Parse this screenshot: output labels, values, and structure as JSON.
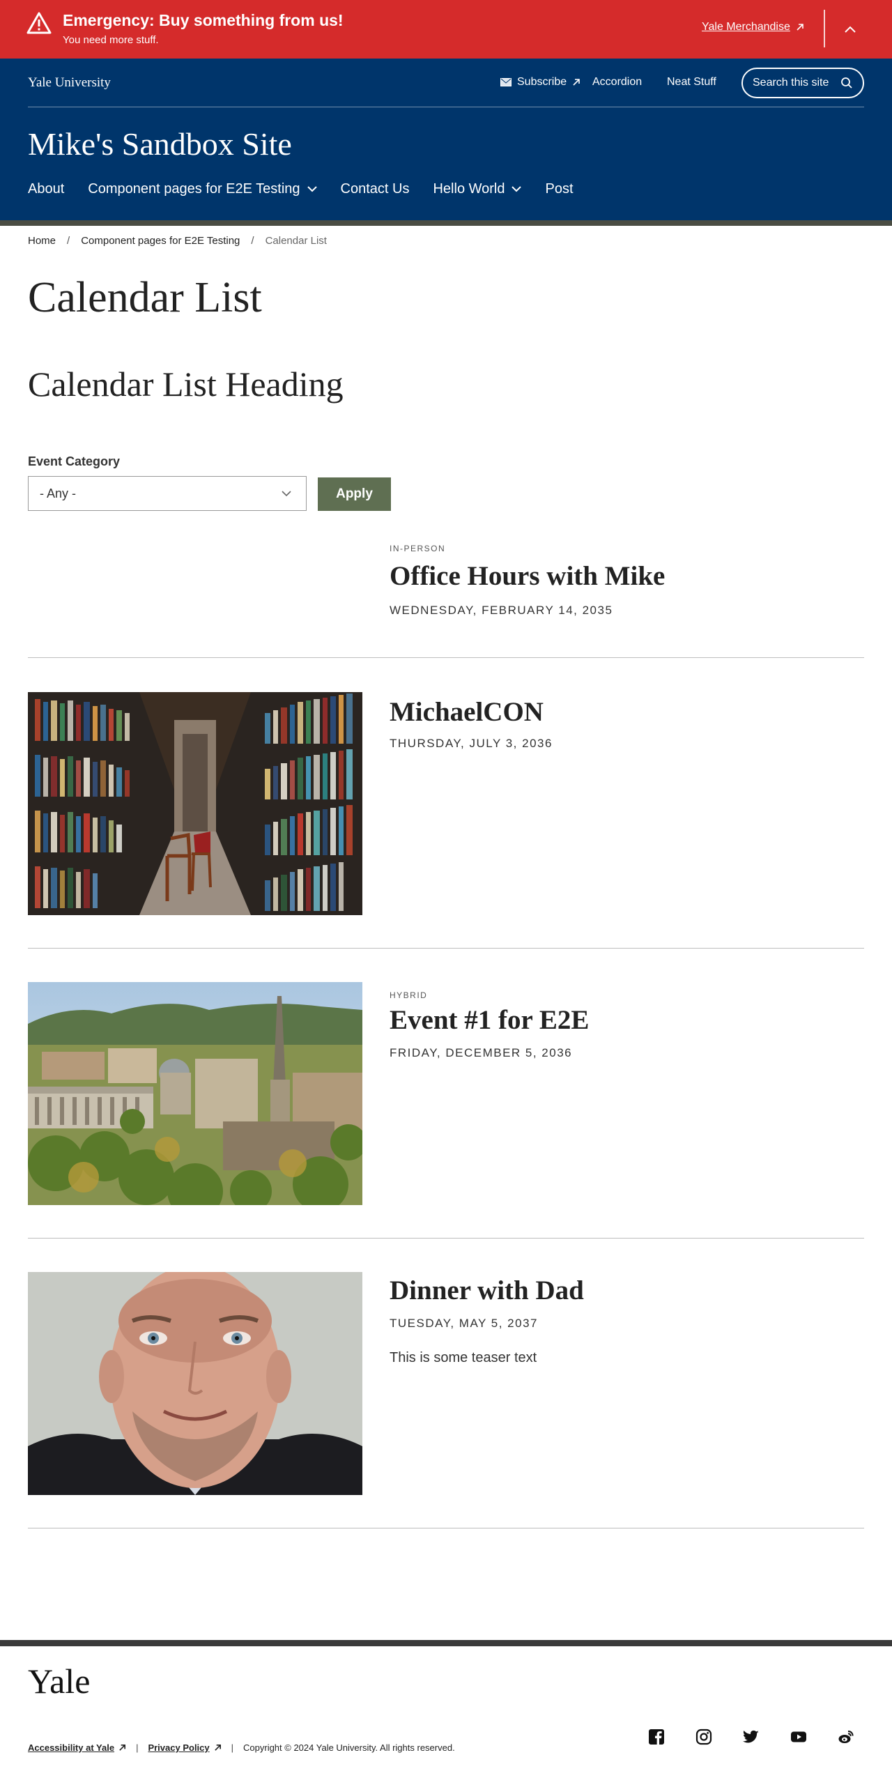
{
  "alert": {
    "title": "Emergency: Buy something from us!",
    "subtitle": "You need more stuff.",
    "link_label": "Yale Merchandise"
  },
  "utility": {
    "yale_label": "Yale University",
    "subscribe_label": "Subscribe",
    "accordion_label": "Accordion",
    "neat_stuff_label": "Neat Stuff",
    "search_placeholder": "Search this site"
  },
  "site_title": "Mike's Sandbox Site",
  "nav": {
    "items": [
      {
        "label": "About"
      },
      {
        "label": "Component pages for E2E Testing"
      },
      {
        "label": "Contact Us"
      },
      {
        "label": "Hello World"
      },
      {
        "label": "Post"
      }
    ]
  },
  "breadcrumb": {
    "items": [
      "Home",
      "Component pages for E2E Testing",
      "Calendar List"
    ],
    "separator": "/"
  },
  "page_title": "Calendar List",
  "section_heading": "Calendar List Heading",
  "filter": {
    "label": "Event Category",
    "selected": "- Any -",
    "apply_label": "Apply"
  },
  "events": [
    {
      "tag": "IN-PERSON",
      "title": "Office Hours with Mike",
      "date": "WEDNESDAY, FEBRUARY 14, 2035",
      "teaser": ""
    },
    {
      "tag": "",
      "title": "MichaelCON",
      "date": "THURSDAY, JULY 3, 2036",
      "teaser": ""
    },
    {
      "tag": "HYBRID",
      "title": "Event #1 for E2E",
      "date": "FRIDAY, DECEMBER 5, 2036",
      "teaser": ""
    },
    {
      "tag": "",
      "title": "Dinner with Dad",
      "date": "TUESDAY, MAY 5, 2037",
      "teaser": "This is some teaser text"
    }
  ],
  "footer": {
    "logo": "Yale",
    "accessibility_label": "Accessibility at Yale",
    "privacy_label": "Privacy Policy",
    "separator": "|",
    "copyright": "Copyright © 2024 Yale University. All rights reserved.",
    "socials": [
      "facebook-icon",
      "instagram-icon",
      "twitter-icon",
      "youtube-icon",
      "weibo-icon"
    ]
  },
  "colors": {
    "alert_red": "#d52b2b",
    "yale_blue": "#00356b",
    "apply_green": "#5f6f52"
  }
}
